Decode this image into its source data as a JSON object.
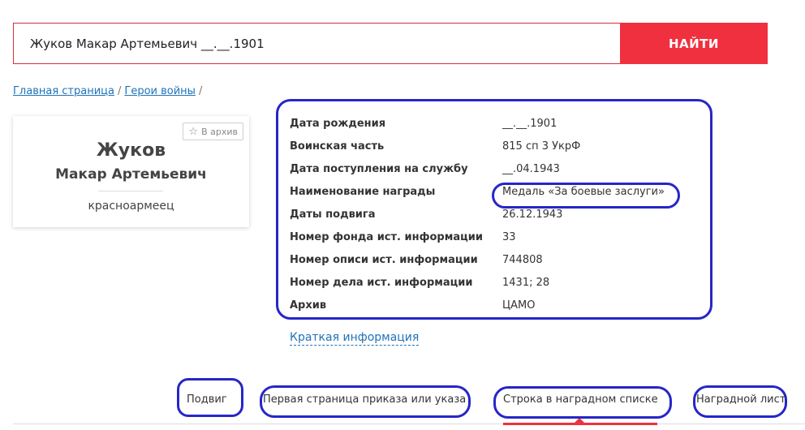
{
  "search": {
    "value": "Жуков Макар Артемьевич __.__.1901",
    "button_label": "НАЙТИ"
  },
  "breadcrumb": {
    "home": "Главная страница",
    "section": "Герои войны",
    "separator": "/"
  },
  "card": {
    "archive_label": "В архив",
    "surname": "Жуков",
    "given_names": "Макар Артемьевич",
    "rank": "красноармеец"
  },
  "info": {
    "rows": [
      {
        "label": "Дата рождения",
        "value": "__.__.1901"
      },
      {
        "label": "Воинская часть",
        "value": "815 сп 3 УкрФ"
      },
      {
        "label": "Дата поступления на службу",
        "value": "__.04.1943"
      },
      {
        "label": "Наименование награды",
        "value": "Медаль «За боевые заслуги»"
      },
      {
        "label": "Даты подвига",
        "value": "26.12.1943"
      },
      {
        "label": "Номер фонда ист. информации",
        "value": "33"
      },
      {
        "label": "Номер описи ист. информации",
        "value": "744808"
      },
      {
        "label": "Номер дела ист. информации",
        "value": "1431; 28"
      },
      {
        "label": "Архив",
        "value": "ЦАМО"
      }
    ],
    "short_info_link": "Краткая информация"
  },
  "tabs": [
    {
      "label": "Подвиг"
    },
    {
      "label": "Первая страница приказа или указа"
    },
    {
      "label": "Строка в наградном списке"
    },
    {
      "label": "Наградной лист"
    }
  ],
  "active_tab": 2,
  "colors": {
    "accent_red": "#f0303e",
    "link_blue": "#1f72b8",
    "annotation_blue": "#2626c8"
  }
}
